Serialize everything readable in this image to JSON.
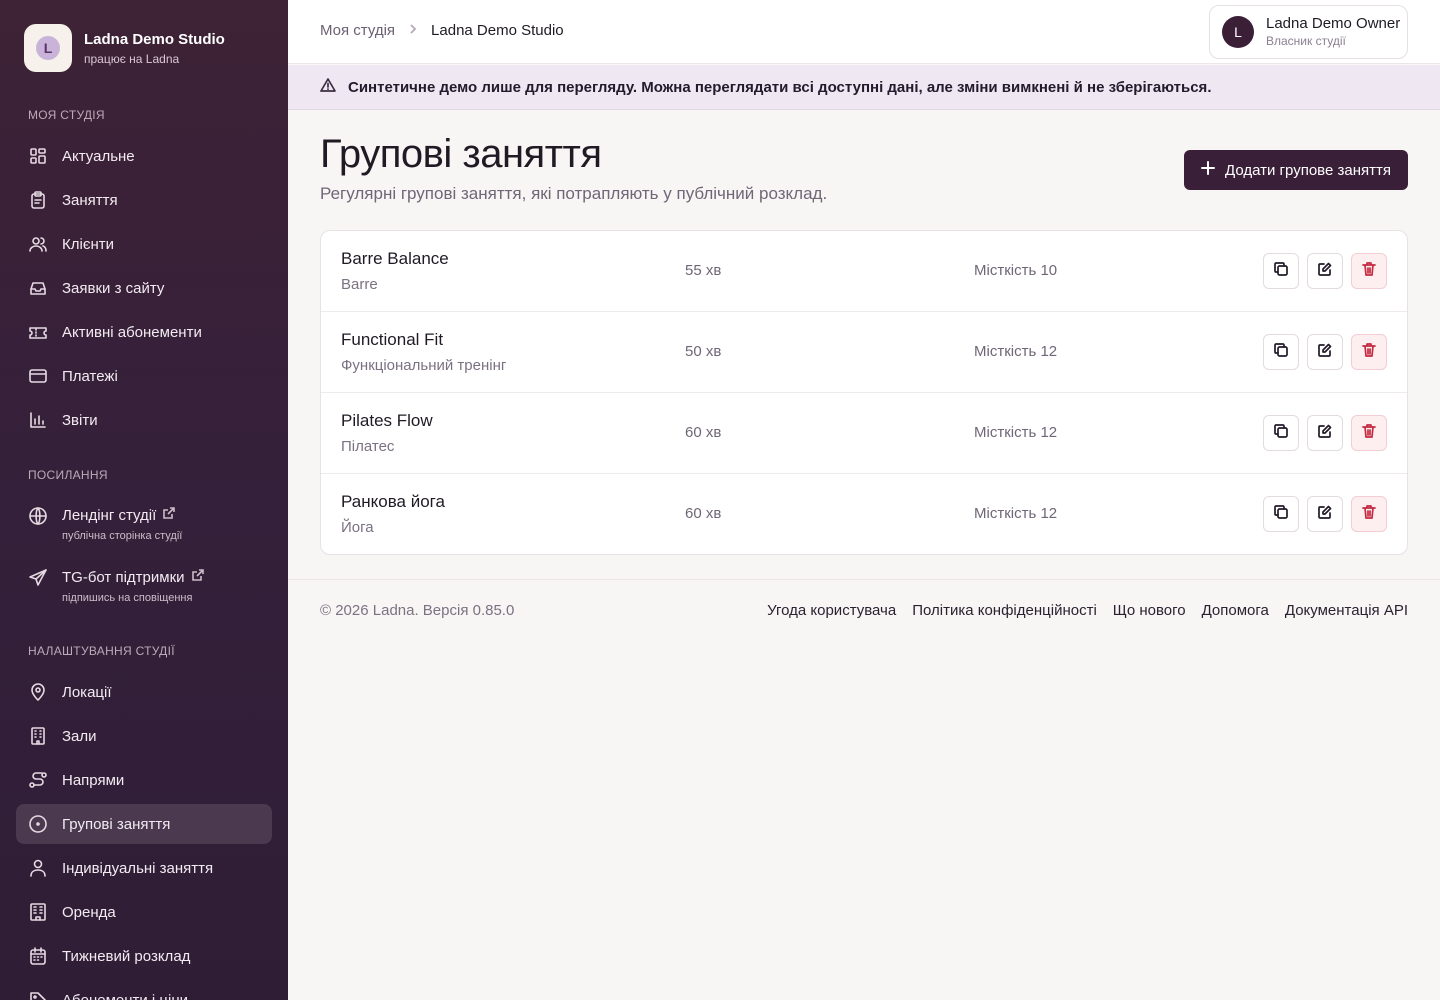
{
  "brand": {
    "name": "Ladna Demo Studio",
    "sub": "працює на Ladna"
  },
  "sidebar": {
    "section_my": "МОЯ СТУДІЯ",
    "my_items": [
      {
        "label": "Актуальне",
        "icon": "dashboard-icon"
      },
      {
        "label": "Заняття",
        "icon": "clipboard-icon"
      },
      {
        "label": "Клієнти",
        "icon": "users-icon"
      },
      {
        "label": "Заявки з сайту",
        "icon": "inbox-icon"
      },
      {
        "label": "Активні абонементи",
        "icon": "ticket-icon"
      },
      {
        "label": "Платежі",
        "icon": "credit-card-icon"
      },
      {
        "label": "Звіти",
        "icon": "bar-chart-icon"
      }
    ],
    "section_links": "ПОСИЛАННЯ",
    "links": [
      {
        "label": "Лендінг студії",
        "sub": "публічна сторінка студії",
        "icon": "globe-icon"
      },
      {
        "label": "TG-бот підтримки",
        "sub": "підпишись на сповіщення",
        "icon": "send-icon"
      }
    ],
    "section_settings": "НАЛАШТУВАННЯ СТУДІЇ",
    "settings_items": [
      {
        "label": "Локації",
        "icon": "map-pin-icon"
      },
      {
        "label": "Зали",
        "icon": "building-icon"
      },
      {
        "label": "Напрями",
        "icon": "route-icon"
      },
      {
        "label": "Групові заняття",
        "icon": "circle-dot-icon",
        "active": true
      },
      {
        "label": "Індивідуальні заняття",
        "icon": "user-icon"
      },
      {
        "label": "Оренда",
        "icon": "office-icon"
      },
      {
        "label": "Тижневий розклад",
        "icon": "calendar-icon"
      },
      {
        "label": "Абонементи і ціни",
        "icon": "tag-icon"
      }
    ]
  },
  "topbar": {
    "breadcrumb": [
      "Моя студія",
      "Ladna Demo Studio"
    ],
    "user": {
      "initial": "L",
      "name": "Ladna Demo Owner",
      "role": "Власник студії"
    }
  },
  "banner": {
    "text": "Синтетичне демо лише для перегляду. Можна переглядати всі доступні дані, але зміни вимкнені й не зберігаються."
  },
  "page": {
    "title": "Групові заняття",
    "subtitle": "Регулярні групові заняття, які потрапляють у публічний розклад.",
    "add_button": "Додати групове заняття"
  },
  "classes": [
    {
      "name": "Barre Balance",
      "category": "Barre",
      "duration": "55 хв",
      "capacity": "Місткість 10"
    },
    {
      "name": "Functional Fit",
      "category": "Функціональний тренінг",
      "duration": "50 хв",
      "capacity": "Місткість 12"
    },
    {
      "name": "Pilates Flow",
      "category": "Пілатес",
      "duration": "60 хв",
      "capacity": "Місткість 12"
    },
    {
      "name": "Ранкова йога",
      "category": "Йога",
      "duration": "60 хв",
      "capacity": "Місткість 12"
    }
  ],
  "footer": {
    "copyright": "© 2026 Ladna. Версія 0.85.0",
    "links": [
      "Угода користувача",
      "Політика конфіденційності",
      "Що нового",
      "Допомога",
      "Документація API"
    ]
  },
  "colors": {
    "sidebar_bg": "#3a1f38",
    "accent": "#3a1f38",
    "danger": "#c42a40",
    "banner_bg": "#efe8f3"
  }
}
